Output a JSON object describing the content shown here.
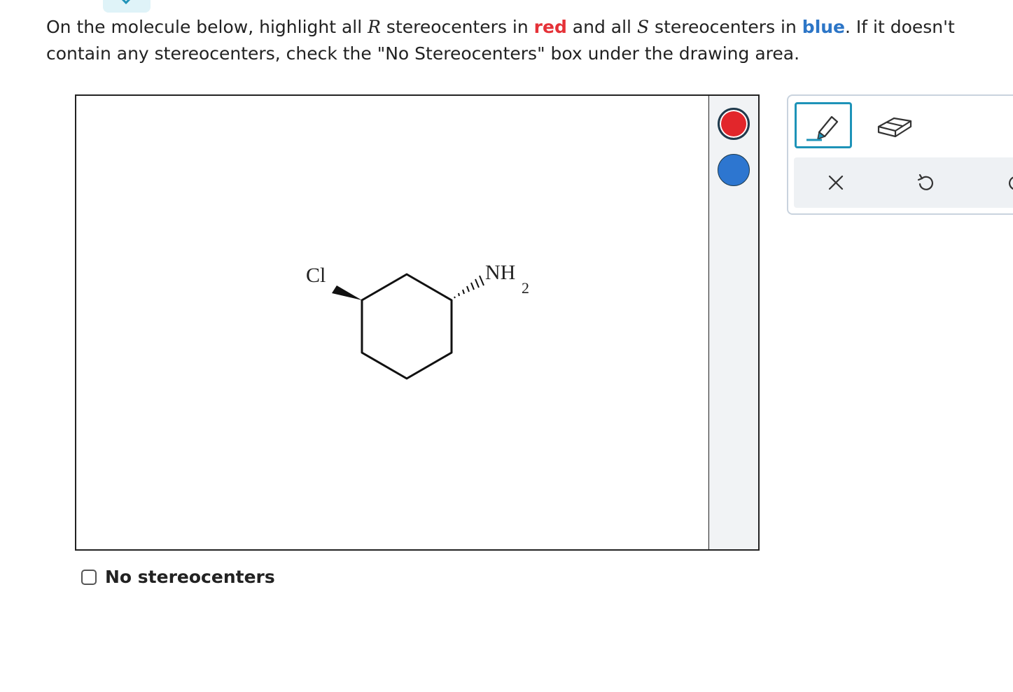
{
  "question": {
    "part1": "On the molecule below, highlight all ",
    "var_r": "R",
    "part2": " stereocenters in ",
    "red_word": "red",
    "part3": " and all ",
    "var_s": "S",
    "part4": " stereocenters in ",
    "blue_word": "blue",
    "part5": ". If it doesn't contain any stereocenters, check the \"No Stereocenters\" box under the drawing area."
  },
  "molecule": {
    "substituent_left": "Cl",
    "substituent_right": "NH",
    "substituent_right_subscript": "2"
  },
  "palette": {
    "colors": {
      "red": "#e2262b",
      "blue": "#2d76d0"
    }
  },
  "toolbox": {
    "tools": [
      "pen-icon",
      "eraser-icon"
    ],
    "actions": [
      "close-icon",
      "undo-icon",
      "redo-icon"
    ],
    "selected_tool": "pen",
    "accent": "#1e93b8"
  },
  "checkbox": {
    "label": "No stereocenters",
    "checked": false
  }
}
